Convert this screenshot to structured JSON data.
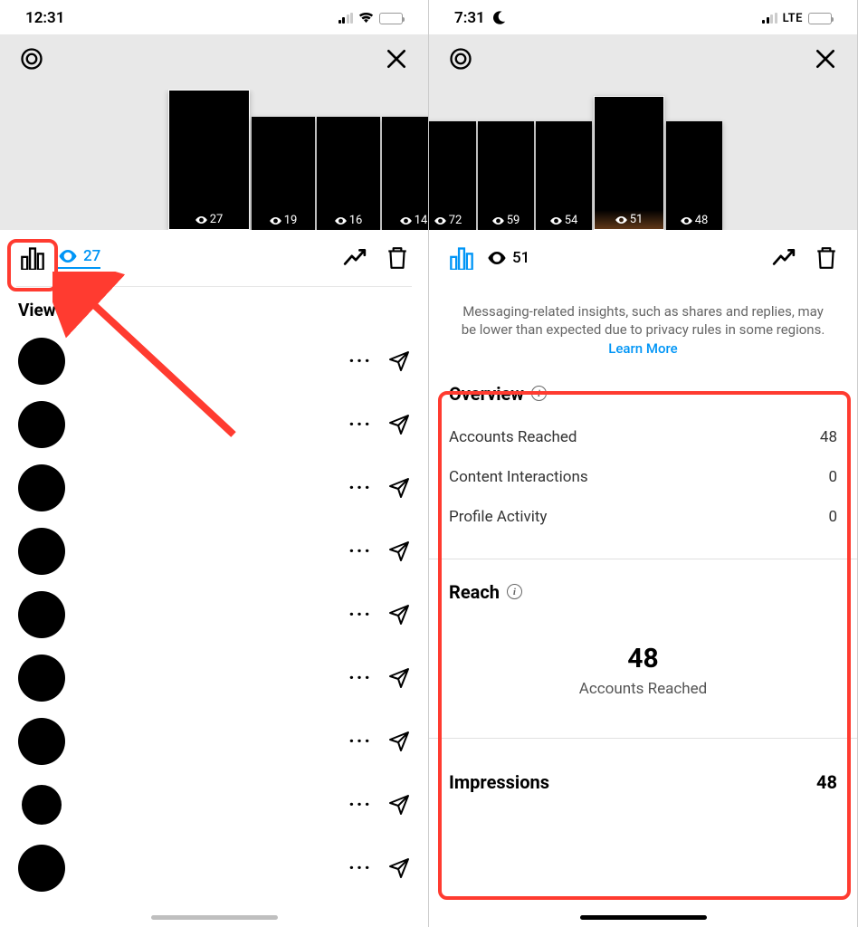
{
  "left": {
    "status_time": "12:31",
    "stories": [
      {
        "count": "27",
        "selected": true
      },
      {
        "count": "19",
        "selected": false
      },
      {
        "count": "16",
        "selected": false
      },
      {
        "count": "14",
        "selected": false
      }
    ],
    "toolbar_views": "27",
    "viewers_title": "Viewers"
  },
  "right": {
    "status_time": "7:31",
    "network": "LTE",
    "stories": [
      {
        "count": "72",
        "selected": false
      },
      {
        "count": "59",
        "selected": false
      },
      {
        "count": "54",
        "selected": false
      },
      {
        "count": "51",
        "selected": true
      },
      {
        "count": "48",
        "selected": false
      }
    ],
    "toolbar_views": "51",
    "notice_text": "Messaging-related insights, such as shares and replies, may be lower than expected due to privacy rules in some regions. ",
    "notice_link": "Learn More",
    "overview_title": "Overview",
    "overview": [
      {
        "label": "Accounts Reached",
        "value": "48"
      },
      {
        "label": "Content Interactions",
        "value": "0"
      },
      {
        "label": "Profile Activity",
        "value": "0"
      }
    ],
    "reach_title": "Reach",
    "reach_big": "48",
    "reach_sub": "Accounts Reached",
    "impressions_label": "Impressions",
    "impressions_value": "48"
  }
}
